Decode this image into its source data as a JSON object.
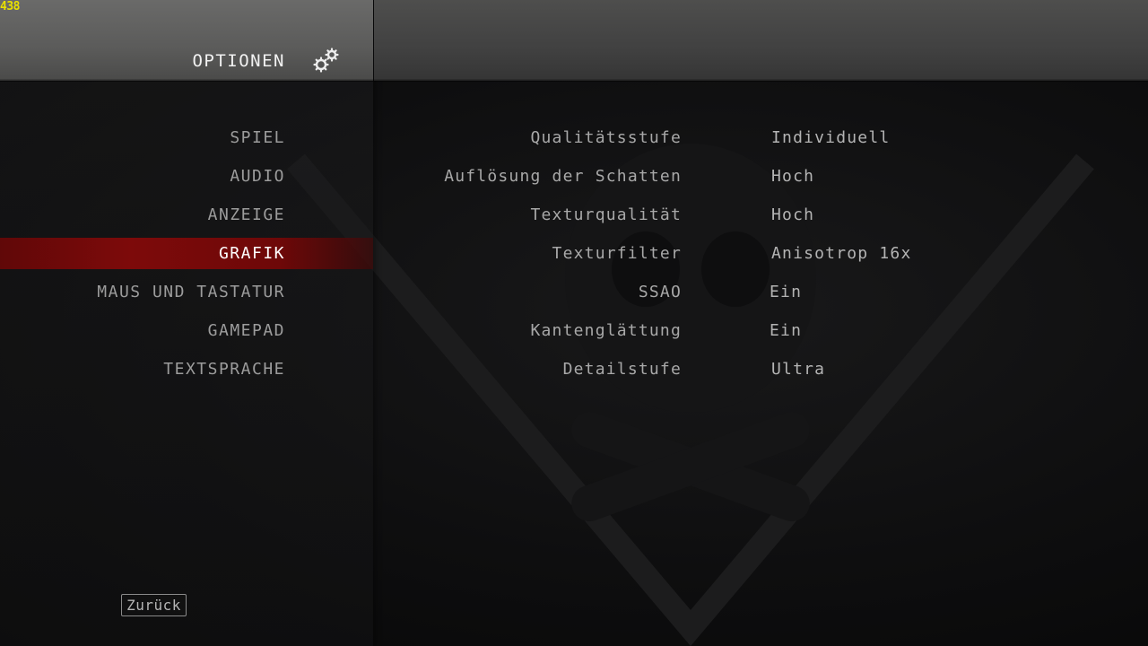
{
  "hud": {
    "fps": "438"
  },
  "header": {
    "title": "OPTIONEN",
    "icon": "gears-icon"
  },
  "menu": {
    "items": [
      {
        "label": "SPIEL",
        "active": false
      },
      {
        "label": "AUDIO",
        "active": false
      },
      {
        "label": "ANZEIGE",
        "active": false
      },
      {
        "label": "GRAFIK",
        "active": true
      },
      {
        "label": "MAUS UND TASTATUR",
        "active": false
      },
      {
        "label": "GAMEPAD",
        "active": false
      },
      {
        "label": "TEXTSPRACHE",
        "active": false
      }
    ]
  },
  "settings": [
    {
      "label": "Qualitätsstufe",
      "value": "Individuell"
    },
    {
      "label": "Auflösung der Schatten",
      "value": "Hoch"
    },
    {
      "label": "Texturqualität",
      "value": "Hoch"
    },
    {
      "label": "Texturfilter",
      "value": "Anisotrop 16x"
    },
    {
      "label": "SSAO",
      "value": "Ein"
    },
    {
      "label": "Kantenglättung",
      "value": "Ein"
    },
    {
      "label": "Detailstufe",
      "value": "Ultra"
    }
  ],
  "footer": {
    "back_label": "Zurück"
  },
  "colors": {
    "accent_active": "#7d0a0a",
    "fps_text": "#e8e000",
    "text_dim": "#9c9c9c",
    "text_bright": "#ffffff"
  }
}
